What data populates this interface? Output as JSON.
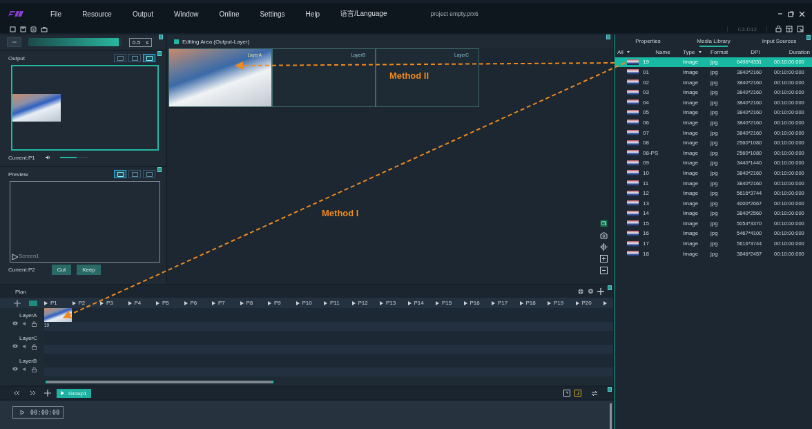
{
  "menu": [
    "File",
    "Resource",
    "Output",
    "Window",
    "Online",
    "Settings",
    "Help",
    "语言/Language"
  ],
  "project_title": "project empty.prx6",
  "screen_code": "C3-D12",
  "transition": {
    "level": 0.96,
    "value": "0.5",
    "unit": "s"
  },
  "output": {
    "title": "Output",
    "view_modes": [
      {
        "selected": false
      },
      {
        "selected": false
      },
      {
        "selected": true
      }
    ],
    "current": "Current:P1",
    "volume": {
      "level": 0.6
    }
  },
  "preview": {
    "title": "Preview",
    "view_modes": [
      {
        "selected": true
      },
      {
        "selected": false
      },
      {
        "selected": false
      }
    ],
    "screen_label": "Screen1",
    "current": "Current:P2",
    "buttons": [
      "Cut",
      "Keep"
    ]
  },
  "editing_area": {
    "title": "Editing Area (Output-Layer)",
    "layers": [
      {
        "name": "LayerA",
        "has_image": true
      },
      {
        "name": "LayerB",
        "has_image": false
      },
      {
        "name": "LayerC",
        "has_image": false
      }
    ]
  },
  "annotations": {
    "method_1": "Method I",
    "method_2": "Method II"
  },
  "right_tabs": [
    {
      "label": "Properties",
      "selected": false
    },
    {
      "label": "Media Library",
      "selected": true
    },
    {
      "label": "Input Sources",
      "selected": false
    }
  ],
  "media_table": {
    "columns": [
      "All",
      "Name",
      "Type",
      "Format",
      "DPI",
      "Duration"
    ],
    "rows": [
      {
        "name": "19",
        "type": "Image",
        "format": "jpg",
        "dpi": "6496*4331",
        "duration": "00:10:00:000",
        "selected": true
      },
      {
        "name": "01",
        "type": "Image",
        "format": "jpg",
        "dpi": "3840*2160",
        "duration": "00:10:00:000",
        "selected": false
      },
      {
        "name": "02",
        "type": "Image",
        "format": "jpg",
        "dpi": "3840*2160",
        "duration": "00:10:00:000",
        "selected": false
      },
      {
        "name": "03",
        "type": "Image",
        "format": "jpg",
        "dpi": "3840*2160",
        "duration": "00:10:00:000",
        "selected": false
      },
      {
        "name": "04",
        "type": "Image",
        "format": "jpg",
        "dpi": "3840*2160",
        "duration": "00:10:00:000",
        "selected": false
      },
      {
        "name": "05",
        "type": "Image",
        "format": "jpg",
        "dpi": "3840*2160",
        "duration": "00:10:00:000",
        "selected": false
      },
      {
        "name": "06",
        "type": "Image",
        "format": "jpg",
        "dpi": "3840*2160",
        "duration": "00:10:00:000",
        "selected": false
      },
      {
        "name": "07",
        "type": "Image",
        "format": "jpg",
        "dpi": "3840*2160",
        "duration": "00:10:00:000",
        "selected": false
      },
      {
        "name": "08",
        "type": "Image",
        "format": "jpg",
        "dpi": "2560*1080",
        "duration": "00:10:00:000",
        "selected": false
      },
      {
        "name": "08-PS",
        "type": "Image",
        "format": "jpg",
        "dpi": "2560*1080",
        "duration": "00:10:00:000",
        "selected": false
      },
      {
        "name": "09",
        "type": "Image",
        "format": "jpg",
        "dpi": "3440*1440",
        "duration": "00:10:00:000",
        "selected": false
      },
      {
        "name": "10",
        "type": "Image",
        "format": "jpg",
        "dpi": "3840*2160",
        "duration": "00:10:00:000",
        "selected": false
      },
      {
        "name": "11",
        "type": "Image",
        "format": "jpg",
        "dpi": "3840*2160",
        "duration": "00:10:00:000",
        "selected": false
      },
      {
        "name": "12",
        "type": "Image",
        "format": "jpg",
        "dpi": "5616*3744",
        "duration": "00:10:00:000",
        "selected": false
      },
      {
        "name": "13",
        "type": "Image",
        "format": "jpg",
        "dpi": "4000*2667",
        "duration": "00:10:00:000",
        "selected": false
      },
      {
        "name": "14",
        "type": "Image",
        "format": "jpg",
        "dpi": "3840*2560",
        "duration": "00:10:00:000",
        "selected": false
      },
      {
        "name": "15",
        "type": "Image",
        "format": "jpg",
        "dpi": "5054*3370",
        "duration": "00:10:00:000",
        "selected": false
      },
      {
        "name": "16",
        "type": "Image",
        "format": "jpg",
        "dpi": "5467*4100",
        "duration": "00:10:00:000",
        "selected": false
      },
      {
        "name": "17",
        "type": "Image",
        "format": "jpg",
        "dpi": "5616*3744",
        "duration": "00:10:00:000",
        "selected": false
      },
      {
        "name": "18",
        "type": "Image",
        "format": "jpg",
        "dpi": "3846*2457",
        "duration": "00:10:00:000",
        "selected": false
      }
    ]
  },
  "plan": {
    "title": "Plan",
    "programs": [
      "P1",
      "P2",
      "P3",
      "P4",
      "P5",
      "P6",
      "P7",
      "P8",
      "P9",
      "P10",
      "P11",
      "P12",
      "P13",
      "P14",
      "P15",
      "P16",
      "P17",
      "P18",
      "P19",
      "P20"
    ],
    "layers": [
      {
        "name": "LayerA",
        "clip": "19"
      },
      {
        "name": "LayerC"
      },
      {
        "name": "LayerB"
      }
    ]
  },
  "group": {
    "label": "Group1"
  },
  "timecode": "00:00:00"
}
